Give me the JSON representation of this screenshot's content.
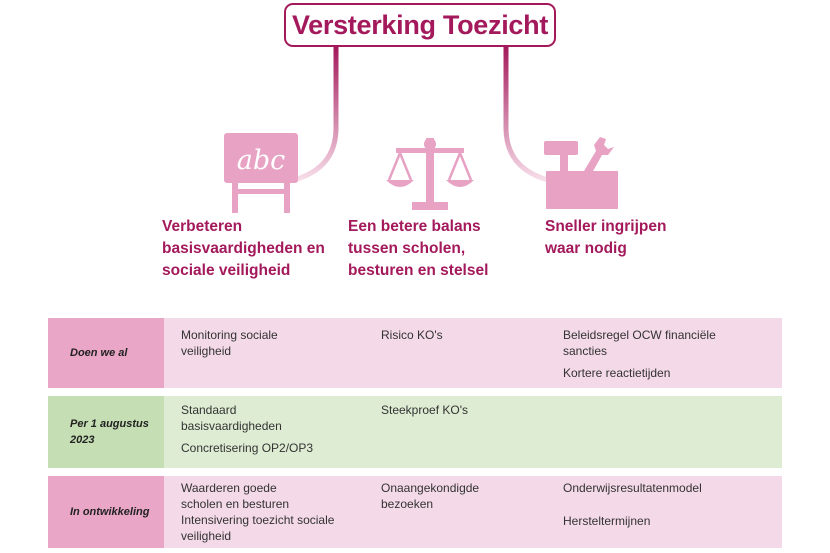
{
  "title": "Versterking Toezicht",
  "colors": {
    "accent": "#a3195b",
    "icon_pink": "#e7a2c4",
    "row_pink_label": "#eaa6c6",
    "row_pink_body": "#f4d9e8",
    "row_green_label": "#c5deb3",
    "row_green_body": "#deecd3"
  },
  "icons": {
    "board_text": "abc",
    "names": [
      "chalkboard-icon",
      "balance-scale-icon",
      "toolbox-icon"
    ]
  },
  "columns": [
    {
      "heading_lines": [
        "Verbeteren",
        "basisvaardigheden en",
        "sociale veiligheid"
      ]
    },
    {
      "heading_lines": [
        "Een betere balans",
        "tussen scholen,",
        "besturen en stelsel"
      ]
    },
    {
      "heading_lines": [
        "Sneller ingrijpen",
        "waar nodig"
      ]
    }
  ],
  "rows": [
    {
      "label_lines": [
        "Doen we al"
      ],
      "cells": [
        [
          "Monitoring sociale",
          "veiligheid"
        ],
        [
          "Risico KO's"
        ],
        [
          "Beleidsregel OCW financiële",
          "sancties",
          "Kortere reactietijden"
        ]
      ]
    },
    {
      "label_lines": [
        "Per 1 augustus",
        "2023"
      ],
      "cells": [
        [
          "Standaard",
          "basisvaardigheden",
          "Concretisering OP2/OP3"
        ],
        [
          "Steekproef KO's"
        ],
        []
      ]
    },
    {
      "label_lines": [
        "In ontwikkeling"
      ],
      "cells": [
        [
          "Waarderen goede",
          "scholen en besturen",
          "Intensivering toezicht sociale",
          "veiligheid"
        ],
        [
          "Onaangekondigde",
          "bezoeken"
        ],
        [
          "Onderwijsresultatenmodel",
          "Hersteltermijnen"
        ]
      ]
    }
  ]
}
